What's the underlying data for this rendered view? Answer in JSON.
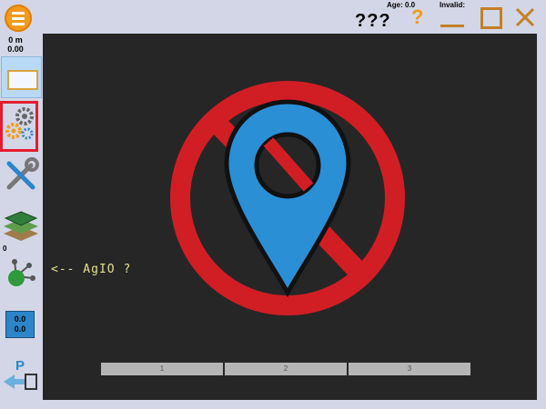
{
  "topbar": {
    "status": "???",
    "age_label": "Age: 0.0",
    "invalid_label": "Invalid:",
    "help": "?"
  },
  "sidebar": {
    "distance": "0 m",
    "distance_value": "0.00",
    "zero_label": "0",
    "readout_top": "0.0",
    "readout_bottom": "0.0"
  },
  "map": {
    "agio_hint": "<-- AgIO ?",
    "pages": [
      "1",
      "2",
      "3"
    ]
  },
  "colors": {
    "accent": "#f29a1e",
    "no_gps_red": "#d11e24",
    "pin_blue": "#2b8fd6"
  }
}
